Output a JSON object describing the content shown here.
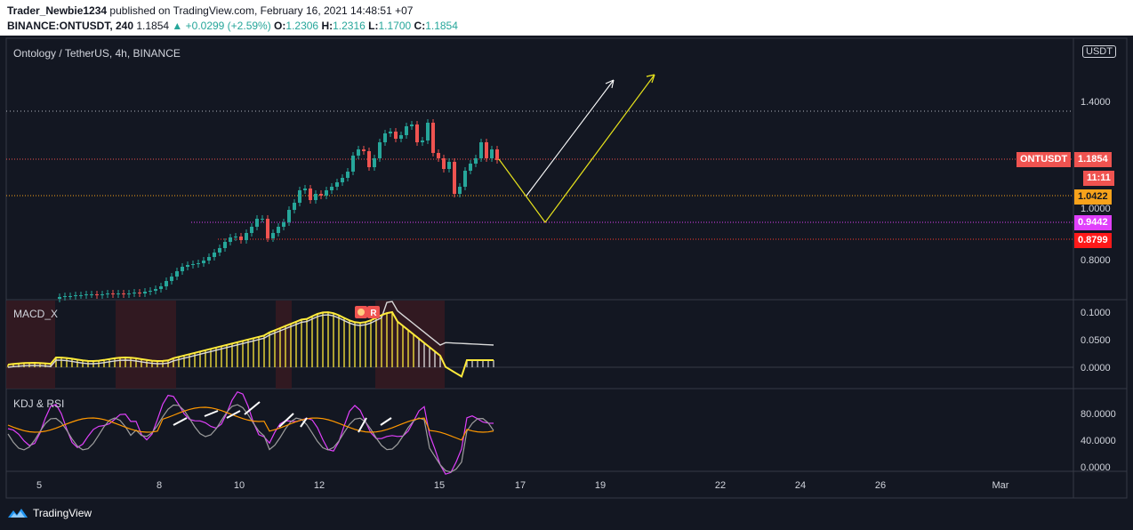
{
  "header": {
    "author": "Trader_Newbie1234",
    "published": "published on TradingView.com, February 16, 2021 14:48:51 +07",
    "symbol_line": "BINANCE:ONTUSDT, 240",
    "last": "1.1854",
    "change": "▲ +0.0299 (+2.59%)",
    "o_label": "O:",
    "o_value": "1.2306",
    "h_label": "H:",
    "h_value": "1.2316",
    "l_label": "L:",
    "l_value": "1.1700",
    "c_label": "C:",
    "c_value": "1.1854"
  },
  "chart": {
    "title": "Ontology / TetherUS, 4h, BINANCE",
    "currency": "USDT",
    "price_axis": [
      "1.4000",
      "1.0000",
      "0.8000"
    ],
    "tags": {
      "symbol_tag": "ONTUSDT",
      "last_price": "1.1854",
      "countdown": "11:11",
      "level_1": "1.0422",
      "level_2": "0.9442",
      "level_3": "0.8799"
    },
    "colors": {
      "up": "#26a69a",
      "down": "#ef5350",
      "background": "#131722",
      "projection_yellow": "#e6e21c",
      "projection_white": "#ffffff"
    }
  },
  "macd": {
    "title": "MACD_X",
    "axis": [
      "0.1000",
      "0.0500",
      "0.0000"
    ],
    "marker": "R"
  },
  "kdj": {
    "title": "KDJ & RSI",
    "axis": [
      "80.0000",
      "40.0000",
      "0.0000"
    ]
  },
  "time_axis": [
    "5",
    "8",
    "10",
    "12",
    "15",
    "17",
    "19",
    "22",
    "24",
    "26",
    "Mar"
  ],
  "footer": {
    "brand": "TradingView"
  }
}
